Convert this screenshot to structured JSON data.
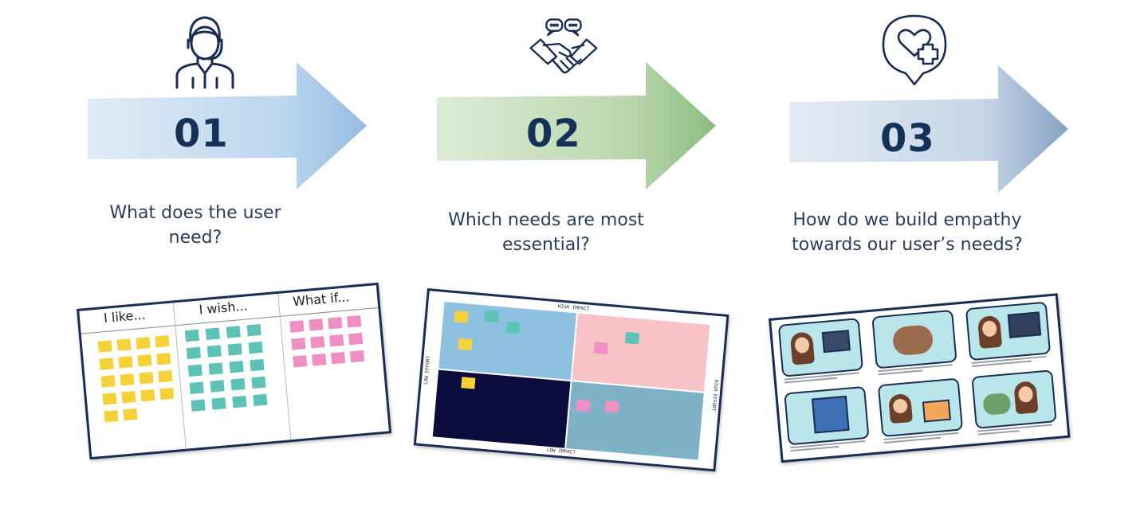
{
  "steps": [
    {
      "number": "01",
      "question_lines": [
        "What does the user",
        "need?"
      ],
      "icon": "support-agent-icon",
      "arrow_color": "#b8d4ee"
    },
    {
      "number": "02",
      "question_lines": [
        "Which needs are most",
        "essential?"
      ],
      "icon": "handshake-icon",
      "arrow_color": "#b5d4a8"
    },
    {
      "number": "03",
      "question_lines": [
        "How do we build empathy",
        "towards our user’s needs?"
      ],
      "icon": "heart-location-icon",
      "arrow_color": "#c3d3e6"
    }
  ],
  "board1": {
    "columns": [
      "I like...",
      "I wish...",
      "What if..."
    ]
  },
  "board2": {
    "top_label": "HIGH IMPACT",
    "bottom_label": "LOW IMPACT",
    "left_label": "LOW EFFORT",
    "right_label": "HIGH EFFORT"
  },
  "colors": {
    "navy": "#1a2d52",
    "sticky_yellow": "#f6d23a",
    "sticky_teal": "#5cc3b6",
    "sticky_pink": "#ef8fc4",
    "quad_blue": "#8ec1e0",
    "quad_pink": "#f7c3c6",
    "quad_navy": "#0b0b3d",
    "quad_slate": "#7fb2c6",
    "card_bg": "#b9e6ea"
  }
}
